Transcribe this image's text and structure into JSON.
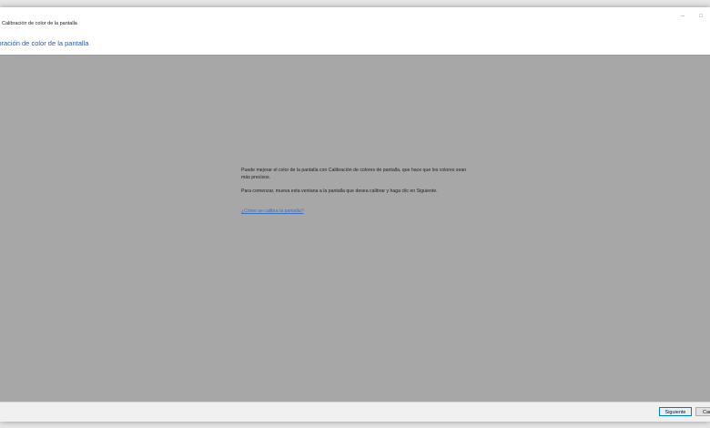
{
  "window": {
    "title": "Calibración de color de la pantalla",
    "controls": {
      "minimize": "–",
      "restore": "□"
    }
  },
  "header": {
    "title": "libración de color de la pantalla"
  },
  "content": {
    "paragraph1": "Puede mejorar el color de la pantalla con Calibración de colores de pantalla, que hace que los colores sean más precisos.",
    "paragraph2": "Para comenzar, mueva esta ventana a la pantalla que desea calibrar y haga clic en Siguiente.",
    "help_link": "¿Cómo se calibra la pantalla?"
  },
  "footer": {
    "next_label": "Siguiente",
    "cancel_label": "Cancelar"
  },
  "colors": {
    "accent": "#2a5aa8",
    "link": "#3f6fbf",
    "content_bg": "#a7a7a7",
    "focus_border": "#0078d7"
  }
}
